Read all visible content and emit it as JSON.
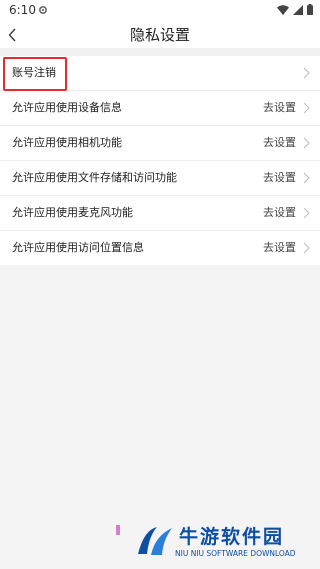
{
  "status_bar": {
    "time": "6:10"
  },
  "header": {
    "title": "隐私设置"
  },
  "settings": {
    "items": [
      {
        "label": "账号注销",
        "action": ""
      },
      {
        "label": "允许应用使用设备信息",
        "action": "去设置"
      },
      {
        "label": "允许应用使用相机功能",
        "action": "去设置"
      },
      {
        "label": "允许应用使用文件存储和访问功能",
        "action": "去设置"
      },
      {
        "label": "允许应用使用麦克风功能",
        "action": "去设置"
      },
      {
        "label": "允许应用使用访问位置信息",
        "action": "去设置"
      }
    ]
  },
  "watermark": {
    "title": "牛游软件园",
    "subtitle": "NIU NIU SOFTWARE DOWNLOAD"
  },
  "colors": {
    "highlight": "#e02d2d",
    "brand": "#0c4fa3"
  }
}
